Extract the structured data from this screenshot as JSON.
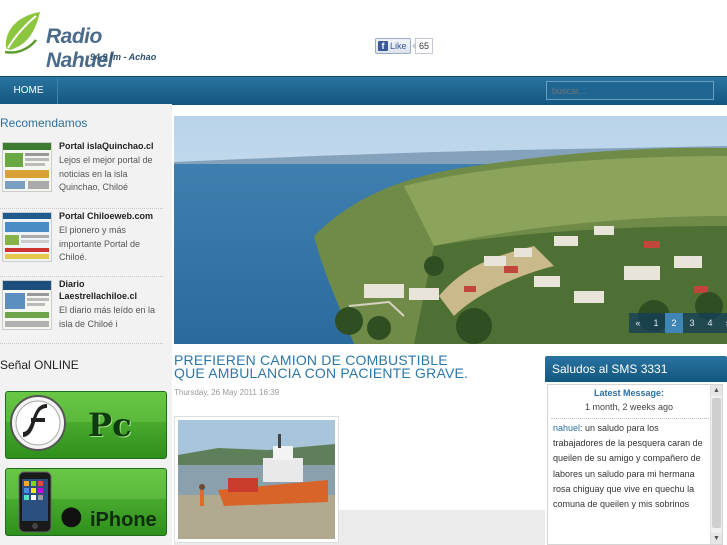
{
  "header": {
    "logo_title": "Radio Nahuel",
    "logo_subtitle": "94.9 fm - Achao",
    "like_label": "Like",
    "like_count": "65"
  },
  "nav": {
    "home": "HOME",
    "search_placeholder": "buscar..."
  },
  "sidebar": {
    "recommend_heading": "Recomendamos",
    "items": [
      {
        "title": "Portal islaQuinchao.cl",
        "desc": "Lejos el mejor portal de noticias en la isla Quinchao, Chiloé"
      },
      {
        "title": "Portal Chiloeweb.com",
        "desc": "El pionero y más importante Portal de Chiloé."
      },
      {
        "title": "Diario Laestrellachiloe.cl",
        "desc": "El diario más leído en la isla de Chiloé i"
      }
    ],
    "online_heading": "Señal ONLINE",
    "online_buttons": [
      {
        "label": "Pc",
        "icon": "flash-icon"
      },
      {
        "label": "iPhone",
        "icon": "apple-icon"
      }
    ]
  },
  "slider": {
    "pages": [
      "«",
      "1",
      "2",
      "3",
      "4",
      "»"
    ],
    "active_page": "2"
  },
  "article": {
    "title": "PREFIEREN CAMION DE COMBUSTIBLE QUE AMBULANCIA CON PACIENTE GRAVE.",
    "date": "Thursday, 26 May 2011 16:39"
  },
  "sms": {
    "heading": "Saludos al SMS 3331",
    "latest_label": "Latest Message:",
    "latest_time": "1 month, 2 weeks ago",
    "message_user": "nahuel",
    "message_text": ": un saludo para los trabajadores de la pesquera caran de queilen de su amigo y compañero de labores un saludo para mi hermana rosa chiguay que vive en quechu la comuna de queilen y mis sobrinos"
  },
  "colors": {
    "nav_blue": "#1a6592",
    "link_blue": "#2b77ab",
    "online_green": "#3ea82a"
  }
}
